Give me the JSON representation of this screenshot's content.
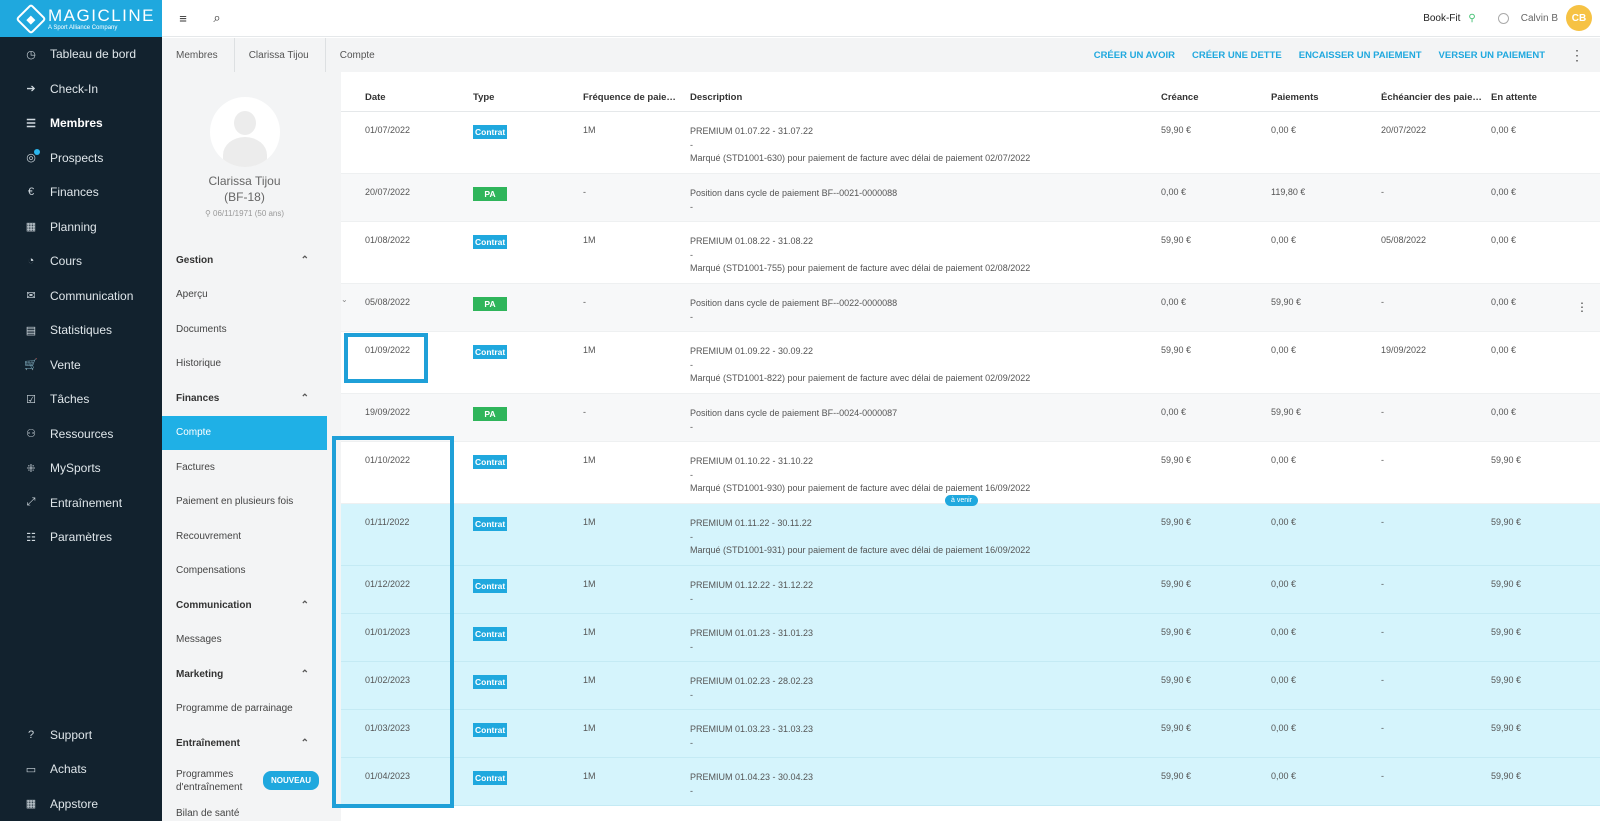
{
  "app": {
    "logo_name": "MAGICLINE",
    "logo_sub": "A Sport Alliance Company"
  },
  "nav": {
    "items": [
      {
        "label": "Tableau de bord",
        "icon": "◷"
      },
      {
        "label": "Check-In",
        "icon": "➔"
      },
      {
        "label": "Membres",
        "icon": "☰",
        "active": true
      },
      {
        "label": "Prospects",
        "icon": "◎",
        "dot": true
      },
      {
        "label": "Finances",
        "icon": "€"
      },
      {
        "label": "Planning",
        "icon": "▦"
      },
      {
        "label": "Cours",
        "icon": "◔"
      },
      {
        "label": "Communication",
        "icon": "✉"
      },
      {
        "label": "Statistiques",
        "icon": "▤"
      },
      {
        "label": "Vente",
        "icon": "🛒"
      },
      {
        "label": "Tâches",
        "icon": "☑"
      },
      {
        "label": "Ressources",
        "icon": "⚇"
      },
      {
        "label": "MySports",
        "icon": "⁜"
      },
      {
        "label": "Entraînement",
        "icon": "⤢"
      },
      {
        "label": "Paramètres",
        "icon": "☷"
      }
    ],
    "bottom": [
      {
        "label": "Support",
        "icon": "?"
      },
      {
        "label": "Achats",
        "icon": "▭"
      },
      {
        "label": "Appstore",
        "icon": "▦"
      }
    ]
  },
  "topbar": {
    "studio": "Book-Fit",
    "user": "Calvin B",
    "initials": "CB"
  },
  "breadcrumb": [
    "Membres",
    "Clarissa Tijou",
    "Compte"
  ],
  "actions": [
    "CRÉER UN AVOIR",
    "CRÉER UNE DETTE",
    "ENCAISSER UN PAIEMENT",
    "VERSER UN PAIEMENT"
  ],
  "member": {
    "name": "Clarissa Tijou",
    "id": "(BF-18)",
    "birth": "06/11/1971 (50 ans)"
  },
  "menu": {
    "gestion": "Gestion",
    "gestion_items": [
      "Aperçu",
      "Documents",
      "Historique"
    ],
    "finances": "Finances",
    "finances_items": [
      "Compte",
      "Factures",
      "Paiement en plusieurs fois",
      "Recouvrement",
      "Compensations"
    ],
    "communication": "Communication",
    "communication_items": [
      "Messages"
    ],
    "marketing": "Marketing",
    "marketing_items": [
      "Programme de parrainage"
    ],
    "entrainement": "Entraînement",
    "prog_line1": "Programmes",
    "prog_line2": "d'entraînement",
    "new_badge": "NOUVEAU",
    "bilan": "Bilan de santé"
  },
  "table": {
    "headers": {
      "date": "Date",
      "type": "Type",
      "freq": "Fréquence de paiement",
      "desc": "Description",
      "creance": "Créance",
      "paiements": "Paiements",
      "echeancier": "Échéancier des paiements",
      "attente": "En attente"
    },
    "future_label": "à venir",
    "rows": [
      {
        "date": "01/07/2022",
        "type": "Contrat",
        "kind": "contrat",
        "freq": "1M",
        "d1": "PREMIUM 01.07.22 - 31.07.22",
        "d2": "-",
        "d3": "Marqué (STD1001-630) pour paiement de facture avec délai de paiement 02/07/2022",
        "creance": "59,90 €",
        "paiements": "0,00 €",
        "echeancier": "20/07/2022",
        "attente": "0,00 €",
        "style": "",
        "h": 62
      },
      {
        "date": "20/07/2022",
        "type": "PA",
        "kind": "pa",
        "freq": "-",
        "d1": "Position dans cycle de paiement BF--0021-0000088",
        "d2": "-",
        "d3": "",
        "creance": "0,00 €",
        "paiements": "119,80 €",
        "echeancier": "-",
        "attente": "0,00 €",
        "style": "grey",
        "h": 48
      },
      {
        "date": "01/08/2022",
        "type": "Contrat",
        "kind": "contrat",
        "freq": "1M",
        "d1": "PREMIUM 01.08.22 - 31.08.22",
        "d2": "-",
        "d3": "Marqué (STD1001-755) pour paiement de facture avec délai de paiement 02/08/2022",
        "creance": "59,90 €",
        "paiements": "0,00 €",
        "echeancier": "05/08/2022",
        "attente": "0,00 €",
        "style": "",
        "h": 62
      },
      {
        "date": "05/08/2022",
        "type": "PA",
        "kind": "pa",
        "freq": "-",
        "d1": "Position dans cycle de paiement BF--0022-0000088",
        "d2": "-",
        "d3": "",
        "creance": "0,00 €",
        "paiements": "59,90 €",
        "echeancier": "-",
        "attente": "0,00 €",
        "style": "grey",
        "h": 48,
        "expand": true
      },
      {
        "date": "01/09/2022",
        "type": "Contrat",
        "kind": "contrat",
        "freq": "1M",
        "d1": "PREMIUM 01.09.22 - 30.09.22",
        "d2": "-",
        "d3": "Marqué (STD1001-822) pour paiement de facture avec délai de paiement 02/09/2022",
        "creance": "59,90 €",
        "paiements": "0,00 €",
        "echeancier": "19/09/2022",
        "attente": "0,00 €",
        "style": "",
        "h": 62
      },
      {
        "date": "19/09/2022",
        "type": "PA",
        "kind": "pa",
        "freq": "-",
        "d1": "Position dans cycle de paiement BF--0024-0000087",
        "d2": "-",
        "d3": "",
        "creance": "0,00 €",
        "paiements": "59,90 €",
        "echeancier": "-",
        "attente": "0,00 €",
        "style": "grey",
        "h": 48
      },
      {
        "date": "01/10/2022",
        "type": "Contrat",
        "kind": "contrat",
        "freq": "1M",
        "d1": "PREMIUM 01.10.22 - 31.10.22",
        "d2": "-",
        "d3": "Marqué (STD1001-930) pour paiement de facture avec délai de paiement 16/09/2022",
        "creance": "59,90 €",
        "paiements": "0,00 €",
        "echeancier": "-",
        "attente": "59,90 €",
        "style": "",
        "h": 62
      },
      {
        "date": "01/11/2022",
        "type": "Contrat",
        "kind": "contrat",
        "freq": "1M",
        "d1": "PREMIUM 01.11.22 - 30.11.22",
        "d2": "-",
        "d3": "Marqué (STD1001-931) pour paiement de facture avec délai de paiement 16/09/2022",
        "creance": "59,90 €",
        "paiements": "0,00 €",
        "echeancier": "-",
        "attente": "59,90 €",
        "style": "future",
        "h": 62
      },
      {
        "date": "01/12/2022",
        "type": "Contrat",
        "kind": "contrat",
        "freq": "1M",
        "d1": "PREMIUM 01.12.22 - 31.12.22",
        "d2": "-",
        "d3": "",
        "creance": "59,90 €",
        "paiements": "0,00 €",
        "echeancier": "-",
        "attente": "59,90 €",
        "style": "future",
        "h": 48
      },
      {
        "date": "01/01/2023",
        "type": "Contrat",
        "kind": "contrat",
        "freq": "1M",
        "d1": "PREMIUM 01.01.23 - 31.01.23",
        "d2": "-",
        "d3": "",
        "creance": "59,90 €",
        "paiements": "0,00 €",
        "echeancier": "-",
        "attente": "59,90 €",
        "style": "future",
        "h": 48
      },
      {
        "date": "01/02/2023",
        "type": "Contrat",
        "kind": "contrat",
        "freq": "1M",
        "d1": "PREMIUM 01.02.23 - 28.02.23",
        "d2": "-",
        "d3": "",
        "creance": "59,90 €",
        "paiements": "0,00 €",
        "echeancier": "-",
        "attente": "59,90 €",
        "style": "future",
        "h": 48
      },
      {
        "date": "01/03/2023",
        "type": "Contrat",
        "kind": "contrat",
        "freq": "1M",
        "d1": "PREMIUM 01.03.23 - 31.03.23",
        "d2": "-",
        "d3": "",
        "creance": "59,90 €",
        "paiements": "0,00 €",
        "echeancier": "-",
        "attente": "59,90 €",
        "style": "future",
        "h": 48
      },
      {
        "date": "01/04/2023",
        "type": "Contrat",
        "kind": "contrat",
        "freq": "1M",
        "d1": "PREMIUM 01.04.23 - 30.04.23",
        "d2": "-",
        "d3": "",
        "creance": "59,90 €",
        "paiements": "0,00 €",
        "echeancier": "-",
        "attente": "59,90 €",
        "style": "future",
        "h": 48
      }
    ]
  },
  "colors": {
    "accent": "#1fa8de",
    "nav_bg": "#12222e",
    "pa_green": "#2fb55b",
    "future_bg": "#d5f4fc"
  }
}
